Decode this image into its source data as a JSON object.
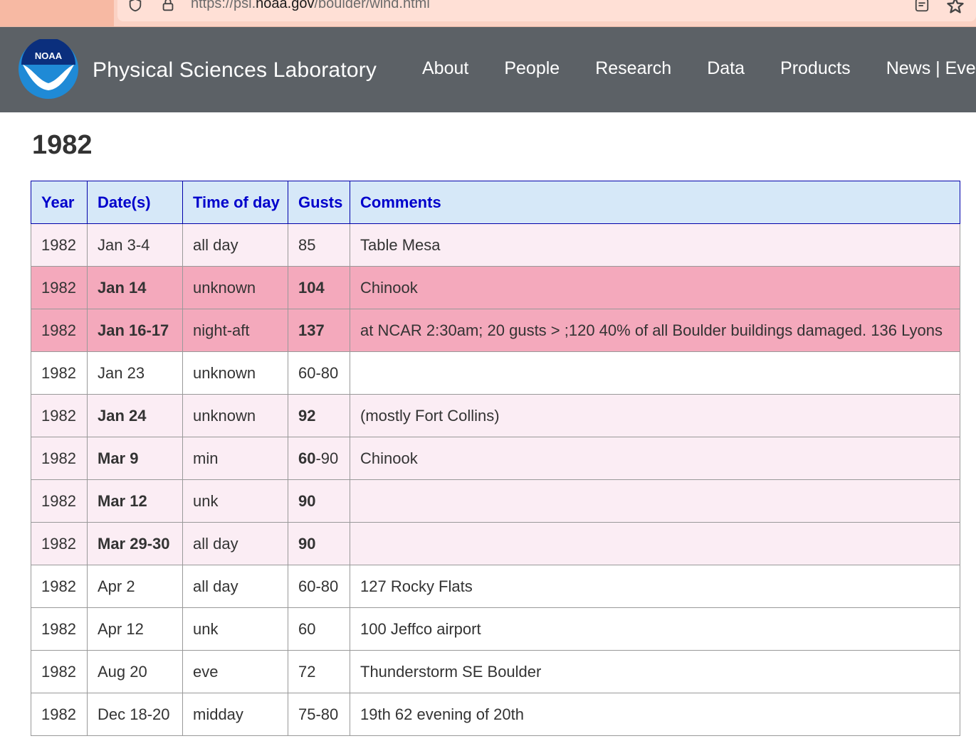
{
  "browser": {
    "url_prefix": "https://psl.",
    "url_domain": "noaa.gov",
    "url_path": "/boulder/wind.html"
  },
  "header": {
    "logo_text": "NOAA",
    "site_title": "Physical Sciences Laboratory",
    "nav": [
      "About",
      "People",
      "Research",
      "Data",
      "Products",
      "News | Ever"
    ]
  },
  "page": {
    "title": "1982"
  },
  "table": {
    "columns": [
      "Year",
      "Date(s)",
      "Time of day",
      "Gusts",
      "Comments"
    ],
    "rows": [
      {
        "year": "1982",
        "date": "Jan 3-4",
        "date_bold": false,
        "time": "all day",
        "gust": "85",
        "gust_bold": "",
        "gust_rest": "85",
        "comment": "Table Mesa",
        "style": "light"
      },
      {
        "year": "1982",
        "date": "Jan 14",
        "date_bold": true,
        "time": "unknown",
        "gust": "104",
        "gust_bold": "104",
        "gust_rest": "",
        "comment": "Chinook",
        "style": "strong"
      },
      {
        "year": "1982",
        "date": "Jan 16-17",
        "date_bold": true,
        "time": "night-aft",
        "gust": "137",
        "gust_bold": "137",
        "gust_rest": "",
        "comment": "at NCAR 2:30am; 20 gusts > ;120 40% of all Boulder buildings damaged. 136 Lyons",
        "style": "strong"
      },
      {
        "year": "1982",
        "date": "Jan 23",
        "date_bold": false,
        "time": "unknown",
        "gust": "60-80",
        "gust_bold": "",
        "gust_rest": "60-80",
        "comment": "",
        "style": "white"
      },
      {
        "year": "1982",
        "date": "Jan 24",
        "date_bold": true,
        "time": "unknown",
        "gust": "92",
        "gust_bold": "92",
        "gust_rest": "",
        "comment": "(mostly Fort Collins)",
        "style": "light"
      },
      {
        "year": "1982",
        "date": "Mar 9",
        "date_bold": true,
        "time": "min",
        "gust": "60-90",
        "gust_bold": "60",
        "gust_rest": "-90",
        "comment": "Chinook",
        "style": "light"
      },
      {
        "year": "1982",
        "date": "Mar 12",
        "date_bold": true,
        "time": "unk",
        "gust": "90",
        "gust_bold": "90",
        "gust_rest": "",
        "comment": "",
        "style": "light"
      },
      {
        "year": "1982",
        "date": "Mar 29-30",
        "date_bold": true,
        "time": "all day",
        "gust": "90",
        "gust_bold": "90",
        "gust_rest": "",
        "comment": "",
        "style": "light"
      },
      {
        "year": "1982",
        "date": "Apr 2",
        "date_bold": false,
        "time": "all day",
        "gust": "60-80",
        "gust_bold": "",
        "gust_rest": "60-80",
        "comment": "127 Rocky Flats",
        "style": "white"
      },
      {
        "year": "1982",
        "date": "Apr 12",
        "date_bold": false,
        "time": "unk",
        "gust": "60",
        "gust_bold": "",
        "gust_rest": "60",
        "comment": "100 Jeffco airport",
        "style": "white"
      },
      {
        "year": "1982",
        "date": "Aug 20",
        "date_bold": false,
        "time": "eve",
        "gust": "72",
        "gust_bold": "",
        "gust_rest": "72",
        "comment": "Thunderstorm SE Boulder",
        "style": "white"
      },
      {
        "year": "1982",
        "date": "Dec 18-20",
        "date_bold": false,
        "time": "midday",
        "gust": "75-80",
        "gust_bold": "",
        "gust_rest": "75-80",
        "comment": "19th 62 evening of 20th",
        "style": "white"
      }
    ]
  },
  "colors": {
    "header_bg": "#5c6166",
    "table_header_bg": "#d6e8f8",
    "table_header_text": "#0000cc",
    "row_light": "#fbedf4",
    "row_strong": "#f4a9bc"
  }
}
